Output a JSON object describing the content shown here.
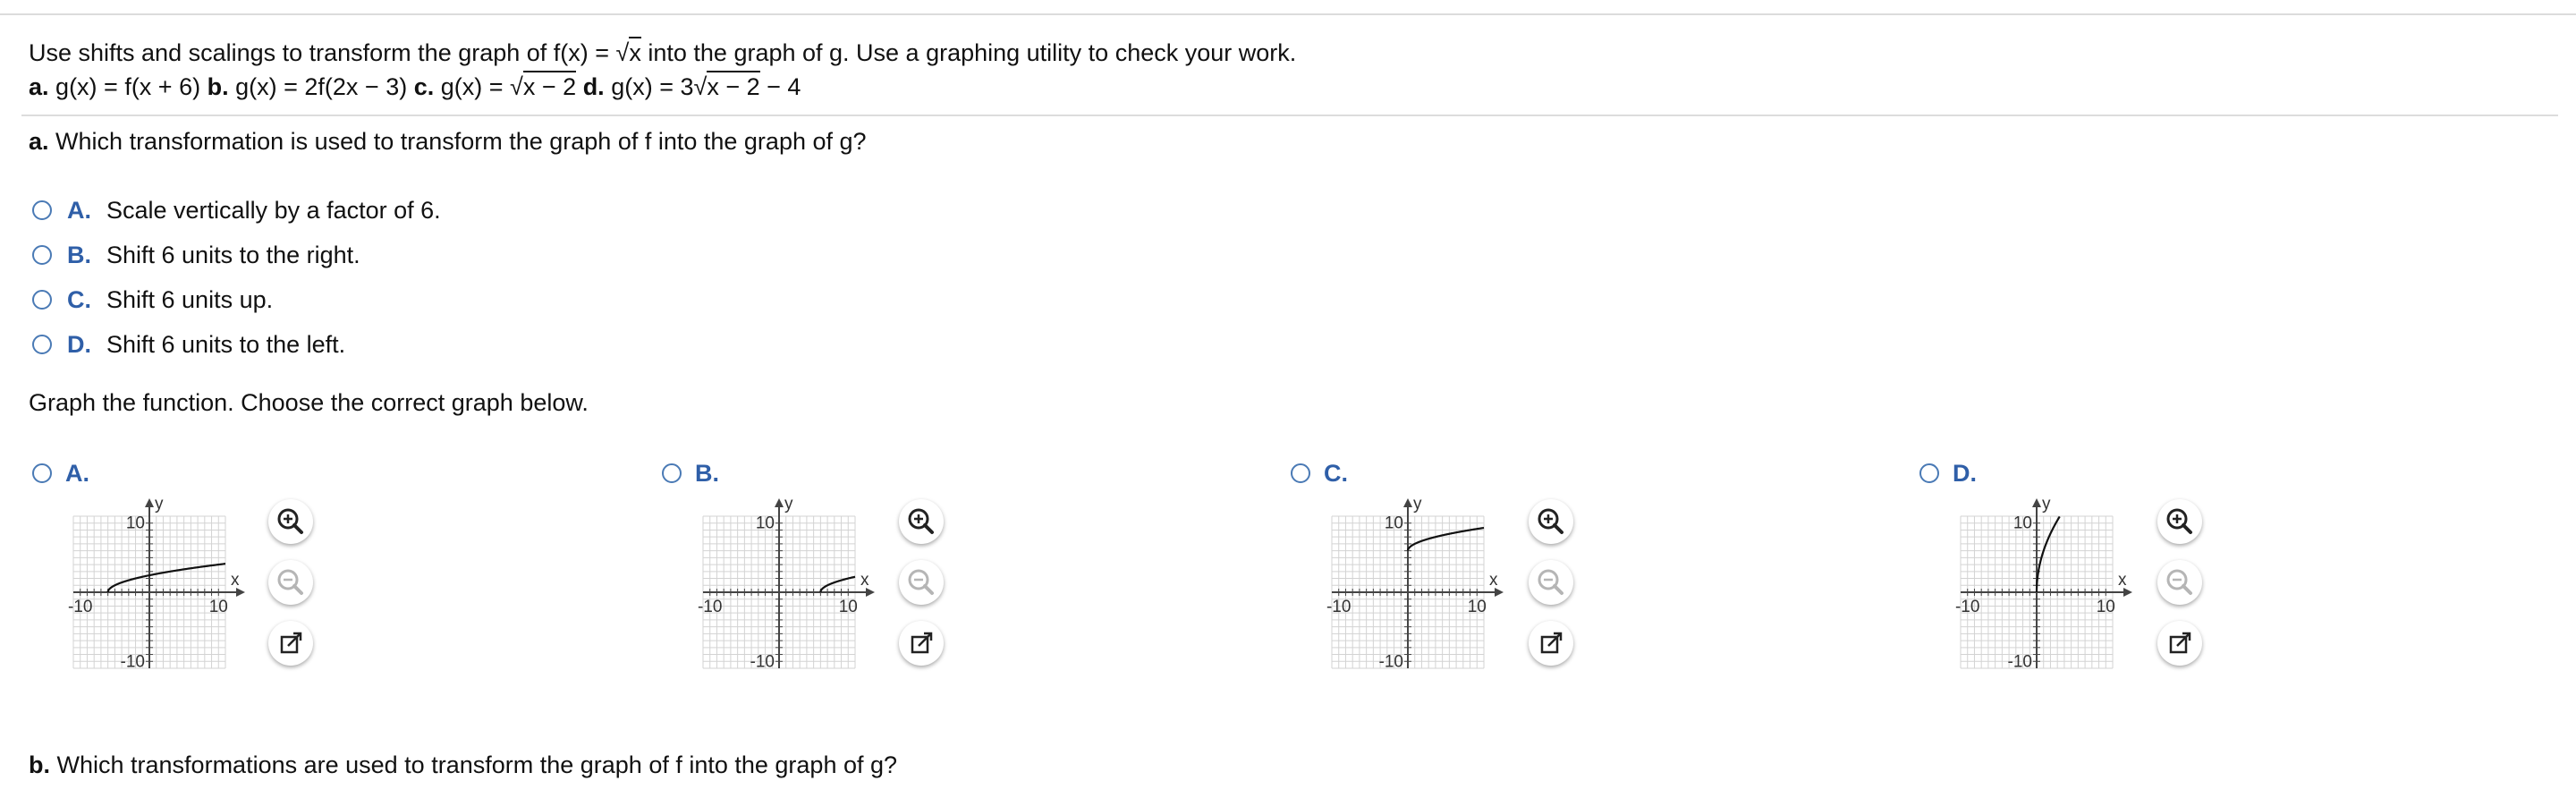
{
  "problem": {
    "line1_pre": "Use shifts and scalings to transform the graph of f(x) = ",
    "line1_radicand": "x",
    "line1_post": " into the graph of g. Use a graphing utility to check your work.",
    "a_label": "a.",
    "a_expr": "g(x) = f(x + 6)",
    "b_label": "b.",
    "b_expr": "g(x) = 2f(2x − 3)",
    "c_label": "c.",
    "c_expr_pre": "g(x) = ",
    "c_radicand": "x − 2",
    "d_label": "d.",
    "d_expr_pre": "g(x) = 3",
    "d_radicand": "x − 2",
    "d_expr_post": " − 4"
  },
  "part_a": {
    "label": "a.",
    "question": "Which transformation is used to transform the graph of f into the graph of g?",
    "options": [
      {
        "letter": "A.",
        "text": "Scale vertically by a factor of 6."
      },
      {
        "letter": "B.",
        "text": "Shift 6 units to the right."
      },
      {
        "letter": "C.",
        "text": "Shift 6 units up."
      },
      {
        "letter": "D.",
        "text": "Shift 6 units to the left."
      }
    ],
    "graph_prompt": "Graph the function. Choose the correct graph below.",
    "graph_options": [
      {
        "letter": "A.",
        "axis_max_label": "10",
        "axis_min_label": "-10",
        "x_label": "x",
        "y_label": "y"
      },
      {
        "letter": "B.",
        "axis_max_label": "10",
        "axis_min_label": "-10",
        "x_label": "x",
        "y_label": "y"
      },
      {
        "letter": "C.",
        "axis_max_label": "10",
        "axis_min_label": "-10",
        "x_label": "x",
        "y_label": "y"
      },
      {
        "letter": "D.",
        "axis_max_label": "10",
        "axis_min_label": "-10",
        "x_label": "x",
        "y_label": "y"
      }
    ]
  },
  "part_b": {
    "label": "b.",
    "question": "Which transformations are used to transform the graph of f into the graph of g?"
  },
  "colors": {
    "radio_border": "#4a7ab5",
    "option_letter": "#2f5fa8",
    "grid": "#d3d3d3",
    "axis": "#444444"
  },
  "icons": [
    "zoom-in-icon",
    "zoom-out-icon",
    "open-external-icon"
  ]
}
